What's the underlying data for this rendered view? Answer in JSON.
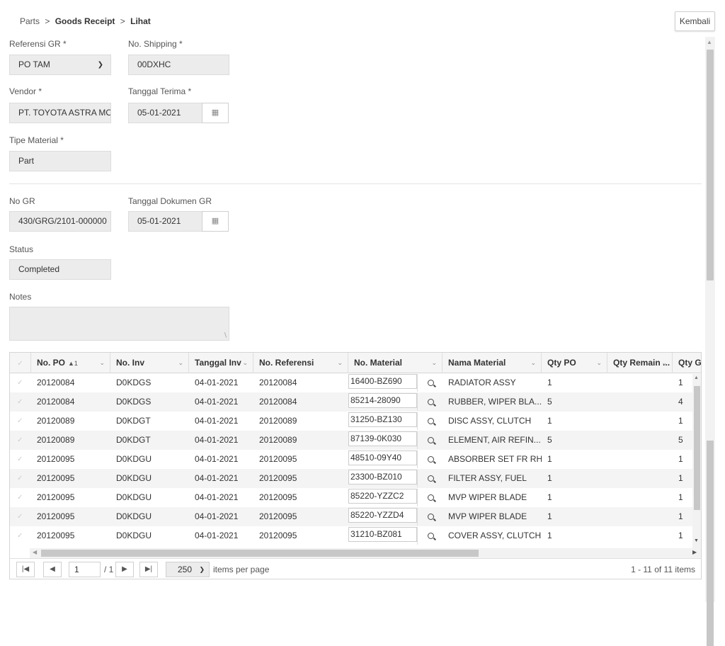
{
  "breadcrumb": {
    "root": "Parts",
    "section": "Goods Receipt",
    "page": "Lihat",
    "separator": ">"
  },
  "buttons": {
    "back": "Kembali"
  },
  "form": {
    "referensi_gr": {
      "label": "Referensi GR *",
      "value": "PO TAM"
    },
    "no_shipping": {
      "label": "No. Shipping *",
      "value": "00DXHC"
    },
    "vendor": {
      "label": "Vendor *",
      "value": "PT. TOYOTA ASTRA MOTOR"
    },
    "tanggal_terima": {
      "label": "Tanggal Terima *",
      "value": "05-01-2021"
    },
    "tipe_material": {
      "label": "Tipe Material *",
      "value": "Part"
    },
    "no_gr": {
      "label": "No GR",
      "value": "430/GRG/2101-000000"
    },
    "tanggal_dokumen_gr": {
      "label": "Tanggal Dokumen GR",
      "value": "05-01-2021"
    },
    "status": {
      "label": "Status",
      "value": "Completed"
    },
    "notes": {
      "label": "Notes",
      "value": ""
    }
  },
  "grid": {
    "columns": [
      {
        "label": "No. PO",
        "sort": "▲1"
      },
      {
        "label": "No. Inv"
      },
      {
        "label": "Tanggal Inv"
      },
      {
        "label": "No. Referensi"
      },
      {
        "label": "No. Material"
      },
      {
        "label": "Nama Material"
      },
      {
        "label": "Qty PO"
      },
      {
        "label": "Qty Remain ..."
      },
      {
        "label": "Qty GR"
      }
    ],
    "rows": [
      {
        "po": "20120084",
        "inv": "D0KDGS",
        "tgl": "04-01-2021",
        "ref": "20120084",
        "mat": "16400-BZ690",
        "nama": "RADIATOR ASSY",
        "qpo": "1",
        "qrem": "",
        "qgr": "1"
      },
      {
        "po": "20120084",
        "inv": "D0KDGS",
        "tgl": "04-01-2021",
        "ref": "20120084",
        "mat": "85214-28090",
        "nama": "RUBBER, WIPER BLA...",
        "qpo": "5",
        "qrem": "",
        "qgr": "4"
      },
      {
        "po": "20120089",
        "inv": "D0KDGT",
        "tgl": "04-01-2021",
        "ref": "20120089",
        "mat": "31250-BZ130",
        "nama": "DISC ASSY, CLUTCH",
        "qpo": "1",
        "qrem": "",
        "qgr": "1"
      },
      {
        "po": "20120089",
        "inv": "D0KDGT",
        "tgl": "04-01-2021",
        "ref": "20120089",
        "mat": "87139-0K030",
        "nama": "ELEMENT, AIR REFIN...",
        "qpo": "5",
        "qrem": "",
        "qgr": "5"
      },
      {
        "po": "20120095",
        "inv": "D0KDGU",
        "tgl": "04-01-2021",
        "ref": "20120095",
        "mat": "48510-09Y40",
        "nama": "ABSORBER SET FR RH",
        "qpo": "1",
        "qrem": "",
        "qgr": "1"
      },
      {
        "po": "20120095",
        "inv": "D0KDGU",
        "tgl": "04-01-2021",
        "ref": "20120095",
        "mat": "23300-BZ010",
        "nama": "FILTER ASSY, FUEL",
        "qpo": "1",
        "qrem": "",
        "qgr": "1"
      },
      {
        "po": "20120095",
        "inv": "D0KDGU",
        "tgl": "04-01-2021",
        "ref": "20120095",
        "mat": "85220-YZZC2",
        "nama": "MVP WIPER BLADE",
        "qpo": "1",
        "qrem": "",
        "qgr": "1"
      },
      {
        "po": "20120095",
        "inv": "D0KDGU",
        "tgl": "04-01-2021",
        "ref": "20120095",
        "mat": "85220-YZZD4",
        "nama": "MVP WIPER BLADE",
        "qpo": "1",
        "qrem": "",
        "qgr": "1"
      },
      {
        "po": "20120095",
        "inv": "D0KDGU",
        "tgl": "04-01-2021",
        "ref": "20120095",
        "mat": "31210-BZ081",
        "nama": "COVER ASSY, CLUTCH",
        "qpo": "1",
        "qrem": "",
        "qgr": "1"
      }
    ]
  },
  "pager": {
    "page": "1",
    "of_pages": "/ 1",
    "page_size": "250",
    "per_page_label": "items per page",
    "summary": "1 - 11 of 11 items"
  },
  "icons": [
    "calendar-icon",
    "chevron-down-icon",
    "search-icon",
    "checkmark-icon",
    "first-page-icon",
    "prev-page-icon",
    "next-page-icon",
    "last-page-icon"
  ]
}
